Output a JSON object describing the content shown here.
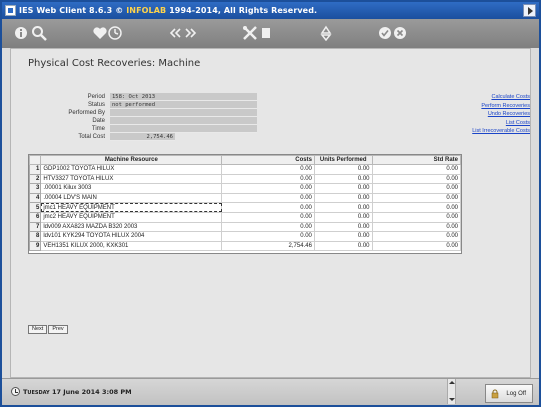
{
  "window": {
    "title_prefix": "IES Web Client 8.6.3 © ",
    "title_brand": "INFOLAB",
    "title_suffix": " 1994-2014, All Rights Reserved."
  },
  "toolbar": {
    "icons": [
      "info-icon",
      "search-icon",
      "favorite-icon",
      "history-icon",
      "back-icon",
      "forward-icon",
      "tools-icon",
      "page-icon",
      "recycle-icon",
      "ok-icon",
      "cancel-icon"
    ]
  },
  "page": {
    "title": "Physical Cost Recoveries: Machine"
  },
  "info": {
    "period_label": "Period",
    "period_value": "158: Oct 2013",
    "status_label": "Status",
    "status_value": "not performed",
    "performed_by_label": "Performed By",
    "performed_by_value": "",
    "date_label": "Date",
    "date_value": "",
    "time_label": "Time",
    "time_value": "",
    "total_cost_label": "Total Cost",
    "total_cost_value": "2,754.46"
  },
  "links": {
    "calculate": "Calculate Costs",
    "perform": "Perform Recoveries",
    "undo": "Undo Recoveries",
    "list_costs": "List Costs",
    "list_irrecoverable": "List Irrecoverable Costs"
  },
  "grid": {
    "columns": [
      "Machine Resource",
      "Costs",
      "Units Performed",
      "Std Rate"
    ],
    "rows": [
      {
        "num": "1",
        "resource": "GDP1002 TOYOTA HILUX",
        "costs": "0.00",
        "units": "0.00",
        "rate": "0.00"
      },
      {
        "num": "2",
        "resource": "HTV3327 TOYOTA HILUX",
        "costs": "0.00",
        "units": "0.00",
        "rate": "0.00"
      },
      {
        "num": "3",
        "resource": ".00001 Kilux 3003",
        "costs": "0.00",
        "units": "0.00",
        "rate": "0.00"
      },
      {
        "num": "4",
        "resource": ".00004 LDV'S MAIN",
        "costs": "0.00",
        "units": "0.00",
        "rate": "0.00"
      },
      {
        "num": "5",
        "resource": "jmc1 HEAVY EQUIPMENT",
        "costs": "0.00",
        "units": "0.00",
        "rate": "0.00"
      },
      {
        "num": "6",
        "resource": "jmc2 HEAVY EQUIPMENT",
        "costs": "0.00",
        "units": "0.00",
        "rate": "0.00"
      },
      {
        "num": "7",
        "resource": "ldv009 AXA823 MAZDA B320 2003",
        "costs": "0.00",
        "units": "0.00",
        "rate": "0.00"
      },
      {
        "num": "8",
        "resource": "ldv101 KYK294 TOYOTA HILUX 2004",
        "costs": "0.00",
        "units": "0.00",
        "rate": "0.00"
      },
      {
        "num": "9",
        "resource": "VEH1351 KILUX 2000, KXK301",
        "costs": "2,754.46",
        "units": "0.00",
        "rate": "0.00"
      }
    ]
  },
  "pager": {
    "next": "Next",
    "prev": "Prev"
  },
  "status": {
    "weekday": "Tuesday",
    "date_rest": "17 June 2014 3:08 PM"
  },
  "logoff": {
    "label": "Log Off"
  }
}
